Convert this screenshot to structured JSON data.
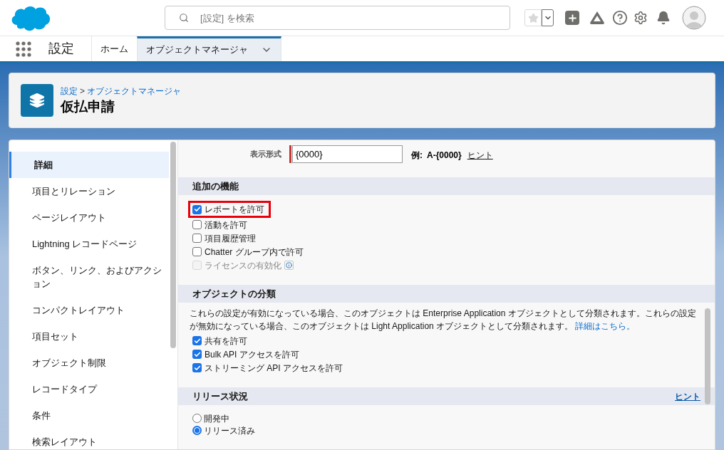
{
  "header": {
    "search": {
      "placeholder": "[設定] を検索"
    }
  },
  "nav": {
    "app_title": "設定",
    "tabs": [
      {
        "label": "ホーム",
        "selected": false,
        "menu": false
      },
      {
        "label": "オブジェクトマネージャ",
        "selected": true,
        "menu": true
      }
    ]
  },
  "page_header": {
    "breadcrumb": [
      "設定",
      "オブジェクトマネージャ"
    ],
    "separator": ">",
    "title": "仮払申請"
  },
  "sidebar": {
    "items": [
      {
        "label": "詳細",
        "selected": true
      },
      {
        "label": "項目とリレーション",
        "selected": false
      },
      {
        "label": "ページレイアウト",
        "selected": false
      },
      {
        "label": "Lightning レコードページ",
        "selected": false
      },
      {
        "label": "ボタン、リンク、およびアクション",
        "selected": false
      },
      {
        "label": "コンパクトレイアウト",
        "selected": false
      },
      {
        "label": "項目セット",
        "selected": false
      },
      {
        "label": "オブジェクト制限",
        "selected": false
      },
      {
        "label": "レコードタイプ",
        "selected": false
      },
      {
        "label": "条件",
        "selected": false
      },
      {
        "label": "検索レイアウト",
        "selected": false
      }
    ]
  },
  "format_field": {
    "label": "表示形式",
    "value": "{0000}",
    "required": true,
    "example_label": "例:",
    "example_value": "A-{0000}",
    "hint": "ヒント"
  },
  "sections": [
    {
      "kind": "checks",
      "title": "追加の機能",
      "items": [
        {
          "label": "レポートを許可",
          "checked": true,
          "disabled": false,
          "highlighted": true,
          "info": false
        },
        {
          "label": "活動を許可",
          "checked": false,
          "disabled": false,
          "highlighted": false,
          "info": false
        },
        {
          "label": "項目履歴管理",
          "checked": false,
          "disabled": false,
          "highlighted": false,
          "info": false
        },
        {
          "label": "Chatter グループ内で許可",
          "checked": false,
          "disabled": false,
          "highlighted": false,
          "info": false
        },
        {
          "label": "ライセンスの有効化",
          "checked": false,
          "disabled": true,
          "highlighted": false,
          "info": true
        }
      ]
    },
    {
      "kind": "classification",
      "title": "オブジェクトの分類",
      "description": "これらの設定が有効になっている場合、このオブジェクトは Enterprise Application オブジェクトとして分類されます。これらの設定が無効になっている場合、このオブジェクトは Light Application オブジェクトとして分類されます。",
      "link": "詳細はこちら。",
      "items": [
        {
          "label": "共有を許可",
          "checked": true,
          "disabled": false,
          "highlighted": false,
          "info": false
        },
        {
          "label": "Bulk API アクセスを許可",
          "checked": true,
          "disabled": false,
          "highlighted": false,
          "info": false
        },
        {
          "label": "ストリーミング API アクセスを許可",
          "checked": true,
          "disabled": false,
          "highlighted": false,
          "info": false
        }
      ]
    },
    {
      "kind": "radios",
      "title": "リリース状況",
      "hint": "ヒント",
      "options": [
        {
          "label": "開発中",
          "selected": false
        },
        {
          "label": "リリース済み",
          "selected": true
        }
      ]
    }
  ]
}
